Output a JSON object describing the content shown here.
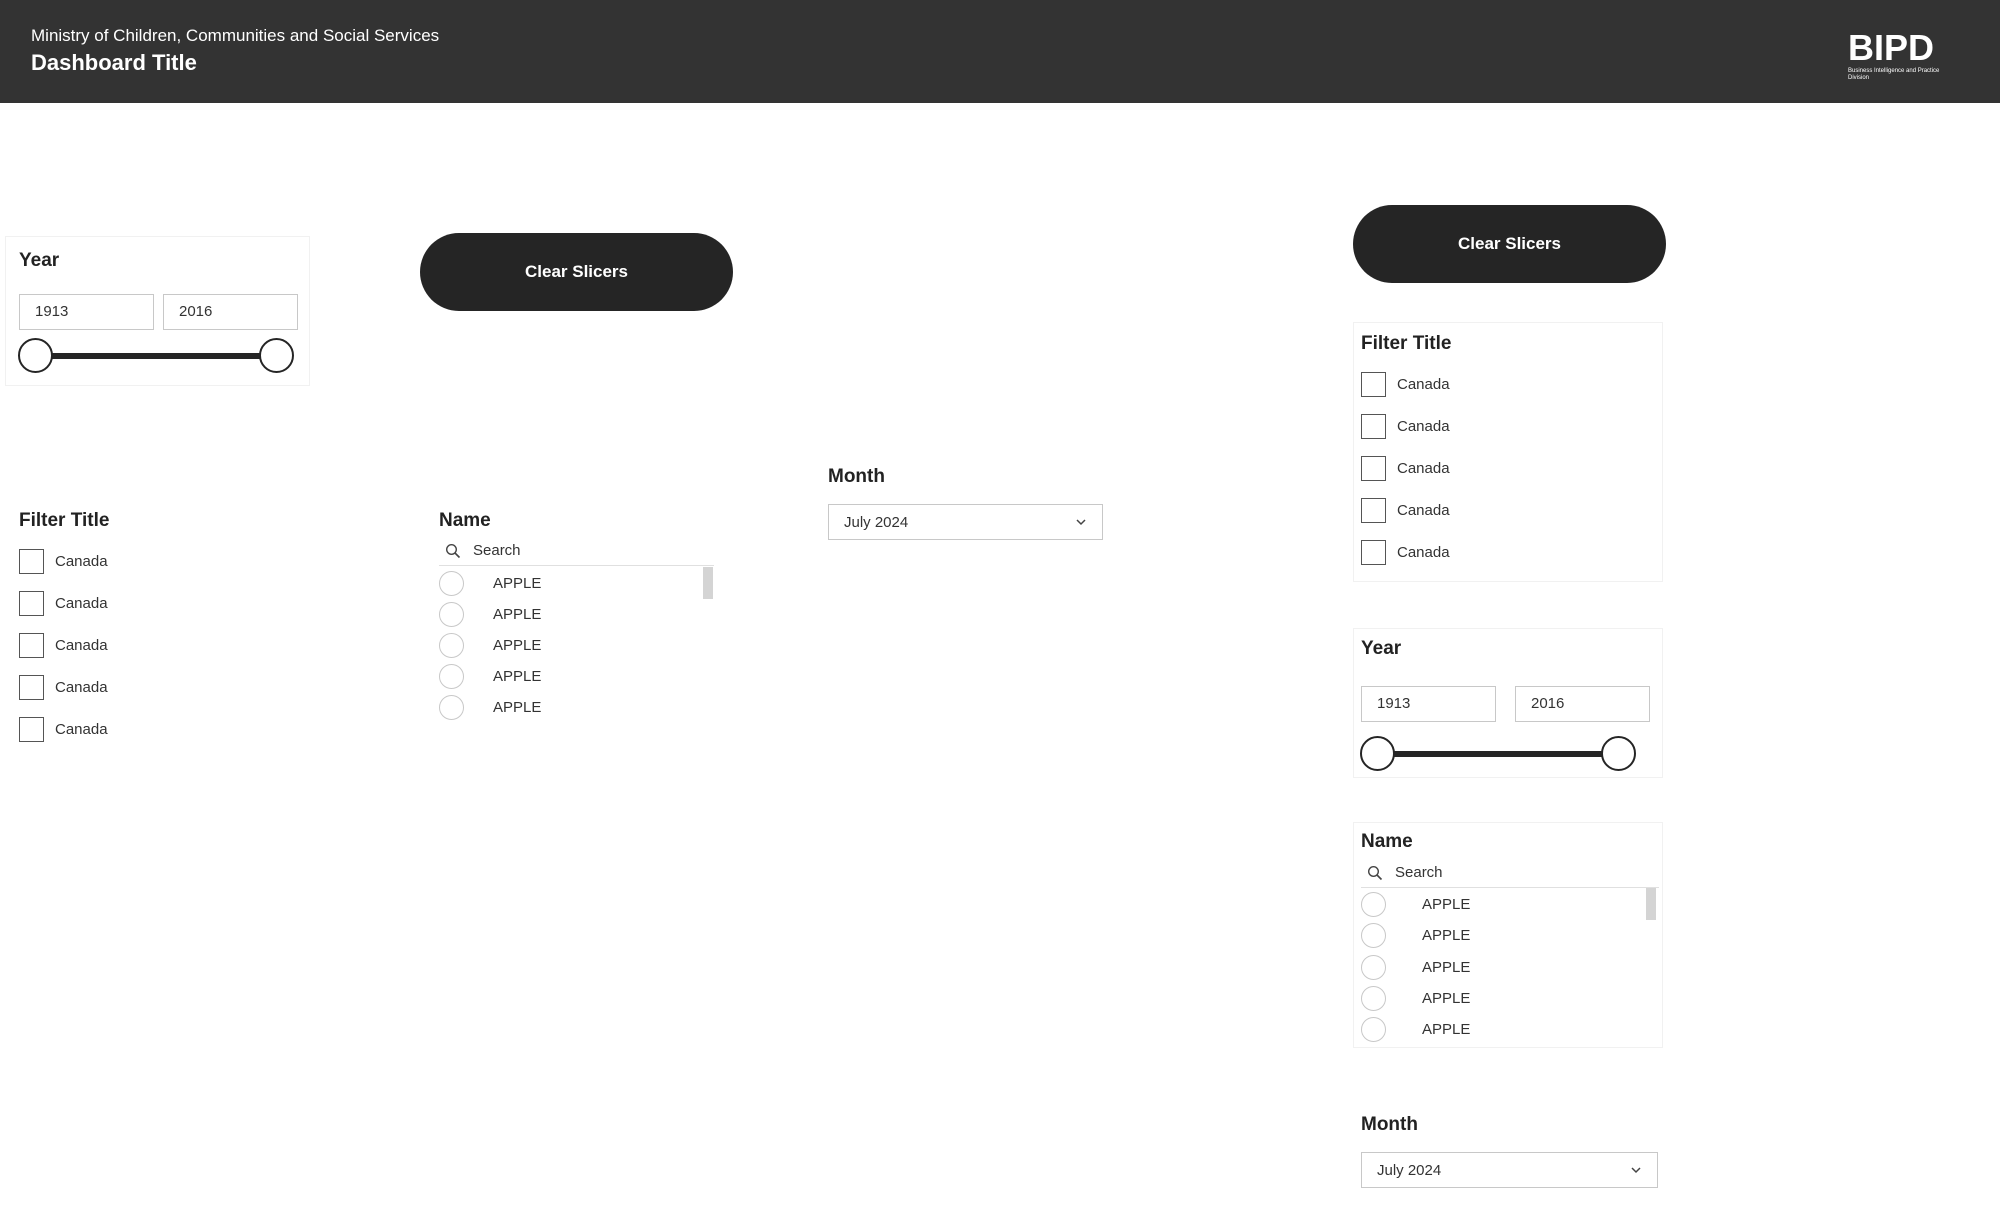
{
  "header": {
    "ministry": "Ministry of Children, Communities and Social Services",
    "title": "Dashboard Title",
    "logo": {
      "text": "BIPD",
      "subtitle": "Business Intelligence and Practice Division"
    }
  },
  "buttons": {
    "clear_slicers": "Clear Slicers"
  },
  "year_slicer": {
    "title": "Year",
    "start": "1913",
    "end": "2016"
  },
  "filter_slicer": {
    "title": "Filter Title",
    "items": [
      "Canada",
      "Canada",
      "Canada",
      "Canada",
      "Canada"
    ]
  },
  "name_slicer": {
    "title": "Name",
    "search_placeholder": "Search",
    "items": [
      "APPLE",
      "APPLE",
      "APPLE",
      "APPLE",
      "APPLE"
    ]
  },
  "month_slicer": {
    "title": "Month",
    "selected": "July 2024"
  },
  "colors": {
    "header_bg": "#333333",
    "button_bg": "#252525",
    "border": "#c8c8c8"
  },
  "icons": [
    "search-icon",
    "chevron-down-icon",
    "bipd-logo"
  ]
}
